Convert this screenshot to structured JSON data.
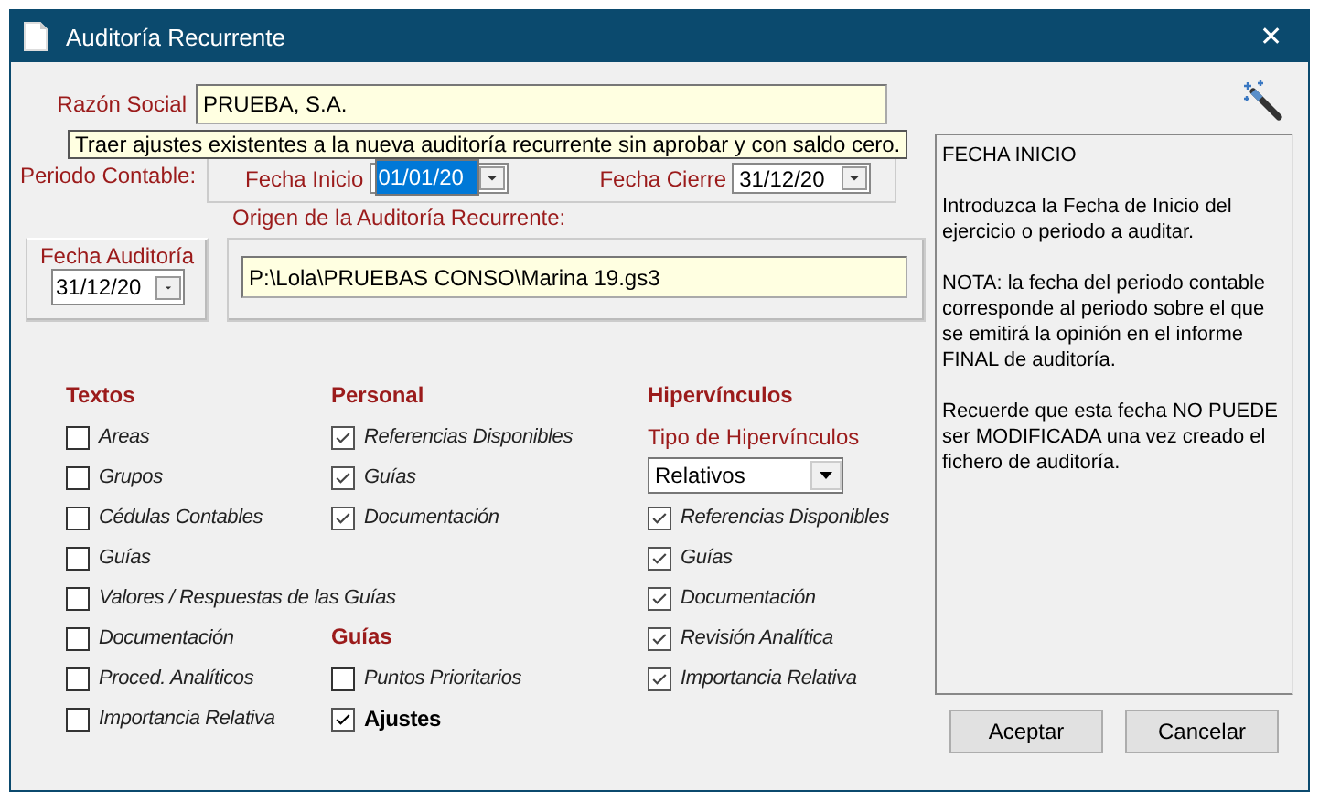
{
  "window": {
    "title": "Auditoría Recurrente",
    "close": "✕"
  },
  "razon_social": {
    "label": "Razón Social",
    "value": "PRUEBA, S.A."
  },
  "tooltip": {
    "text": "Traer ajustes existentes a la nueva auditoría recurrente sin aprobar y con saldo cero."
  },
  "periodo": {
    "label": "Periodo Contable:",
    "fecha_inicio": {
      "label": "Fecha Inicio",
      "value": "01/01/20",
      "selected": true
    },
    "fecha_cierre": {
      "label": "Fecha Cierre",
      "value": "31/12/20",
      "selected": false
    }
  },
  "fecha_auditoria": {
    "label": "Fecha Auditoría",
    "value": "31/12/20"
  },
  "origen": {
    "label": "Origen de la Auditoría Recurrente:",
    "value": "P:\\Lola\\PRUEBAS CONSO\\Marina 19.gs3"
  },
  "textos": {
    "title": "Textos",
    "items": [
      {
        "label": "Areas",
        "checked": false
      },
      {
        "label": "Grupos",
        "checked": false
      },
      {
        "label": "Cédulas Contables",
        "checked": false
      },
      {
        "label": "Guías",
        "checked": false
      },
      {
        "label": "Valores / Respuestas de las Guías",
        "checked": false
      },
      {
        "label": "Documentación",
        "checked": false
      },
      {
        "label": "Proced. Analíticos",
        "checked": false
      },
      {
        "label": "Importancia Relativa",
        "checked": false
      }
    ]
  },
  "personal": {
    "title": "Personal",
    "items": [
      {
        "label": "Referencias Disponibles",
        "checked": true
      },
      {
        "label": "Guías",
        "checked": true
      },
      {
        "label": "Documentación",
        "checked": true
      }
    ]
  },
  "guias": {
    "title": "Guías",
    "items": [
      {
        "label": "Puntos Prioritarios",
        "checked": false,
        "bold": false
      },
      {
        "label": "Ajustes",
        "checked": true,
        "bold": true
      }
    ]
  },
  "hipervinculos": {
    "title": "Hipervínculos",
    "tipo": {
      "label": "Tipo de Hipervínculos",
      "value": "Relativos"
    },
    "items": [
      {
        "label": "Referencias Disponibles",
        "checked": true
      },
      {
        "label": "Guías",
        "checked": true
      },
      {
        "label": "Documentación",
        "checked": true
      },
      {
        "label": "Revisión Analítica",
        "checked": true
      },
      {
        "label": "Importancia Relativa",
        "checked": true
      }
    ]
  },
  "help": {
    "paragraphs": [
      "FECHA INICIO",
      "Introduzca la Fecha de Inicio del ejercicio o periodo a auditar.",
      "NOTA: la fecha del periodo contable corresponde al periodo sobre el que se emitirá la opinión en el informe FINAL de auditoría.",
      "Recuerde que esta fecha NO PUEDE ser MODIFICADA una vez creado el fichero de auditoría."
    ]
  },
  "buttons": [
    "Aceptar",
    "Cancelar"
  ]
}
